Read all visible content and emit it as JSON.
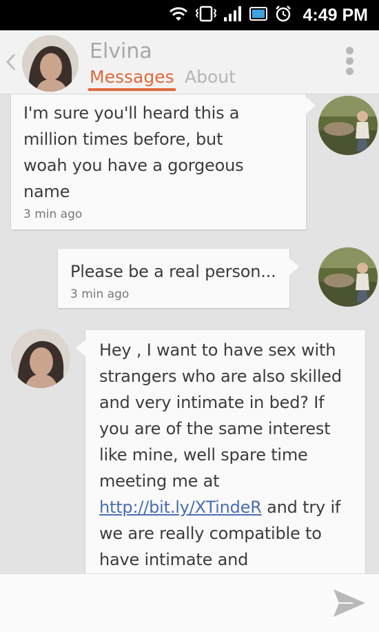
{
  "status_bar": {
    "time": "4:49 PM",
    "icons": [
      "wifi-icon",
      "vibrate-icon",
      "signal-icon",
      "battery-icon",
      "alarm-icon"
    ]
  },
  "header": {
    "name": "Elvina",
    "tabs": [
      {
        "label": "Messages",
        "active": true
      },
      {
        "label": "About",
        "active": false
      }
    ],
    "accent_color": "#e06a3c"
  },
  "messages": [
    {
      "sender": "me",
      "text": "I'm sure you'll heard this a million times before, but woah you have a gorgeous name",
      "time": "3 min ago"
    },
    {
      "sender": "me",
      "text": "Please be a real person...",
      "time": "3 min ago"
    },
    {
      "sender": "Elvina",
      "text_before_link": "Hey , I want to have sex with strangers who are also skilled and very intimate in bed? If you are of the same interest like mine, well spare time meeting me at ",
      "link": "http://bit.ly/XTindeR",
      "text_after_link": " and try if we are really compatible to have intimate and unforgettable"
    }
  ]
}
